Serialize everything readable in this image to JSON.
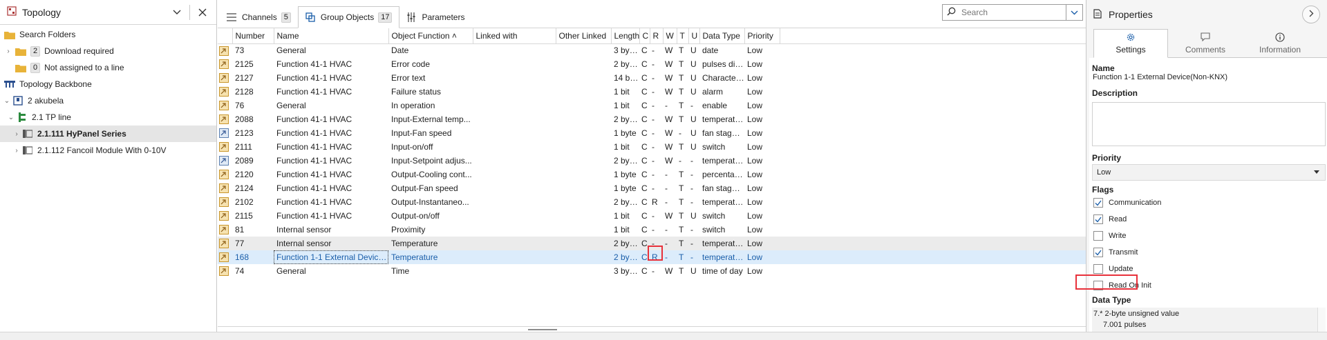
{
  "topology": {
    "title": "Topology",
    "items": [
      {
        "label": "Search Folders",
        "bold": false,
        "level": 0
      },
      {
        "label": "Download required",
        "count": "2",
        "level": 1
      },
      {
        "label": "Not assigned to a line",
        "count": "0",
        "level": 1
      },
      {
        "label": "Topology Backbone",
        "level": 0
      },
      {
        "label": "2 akubela",
        "level": 0
      },
      {
        "label": "2.1 TP line",
        "level": 1
      },
      {
        "label": "2.1.111 HyPanel Series",
        "level": 2
      },
      {
        "label": "2.1.112 Fancoil Module With 0-10V",
        "level": 2
      }
    ]
  },
  "tabs": {
    "channels": {
      "label": "Channels",
      "count": "5"
    },
    "group_objects": {
      "label": "Group Objects",
      "count": "17"
    },
    "parameters": {
      "label": "Parameters"
    }
  },
  "search": {
    "placeholder": "Search"
  },
  "grid": {
    "headers": {
      "number": "Number",
      "name": "Name",
      "object_function": "Object Function ˄",
      "linked_with": "Linked with",
      "other_linked": "Other Linked",
      "length": "Length",
      "c": "C",
      "r": "R",
      "w": "W",
      "t": "T",
      "u": "U",
      "data_type": "Data Type",
      "priority": "Priority"
    },
    "rows": [
      {
        "number": "73",
        "name": "General",
        "func": "Date",
        "length": "3 bytes",
        "c": "C",
        "r": "-",
        "w": "W",
        "t": "T",
        "u": "U",
        "dtype": "date",
        "prio": "Low"
      },
      {
        "number": "2125",
        "name": "Function 41-1 HVAC",
        "func": "Error code",
        "length": "2 bytes",
        "c": "C",
        "r": "-",
        "w": "W",
        "t": "T",
        "u": "U",
        "dtype": "pulses diff...",
        "prio": "Low"
      },
      {
        "number": "2127",
        "name": "Function 41-1 HVAC",
        "func": "Error text",
        "length": "14 bytes",
        "c": "C",
        "r": "-",
        "w": "W",
        "t": "T",
        "u": "U",
        "dtype": "Character...",
        "prio": "Low"
      },
      {
        "number": "2128",
        "name": "Function 41-1 HVAC",
        "func": "Failure status",
        "length": "1 bit",
        "c": "C",
        "r": "-",
        "w": "W",
        "t": "T",
        "u": "U",
        "dtype": "alarm",
        "prio": "Low"
      },
      {
        "number": "76",
        "name": "General",
        "func": "In operation",
        "length": "1 bit",
        "c": "C",
        "r": "-",
        "w": "-",
        "t": "T",
        "u": "-",
        "dtype": "enable",
        "prio": "Low"
      },
      {
        "number": "2088",
        "name": "Function 41-1 HVAC",
        "func": "Input-External temp...",
        "length": "2 bytes",
        "c": "C",
        "r": "-",
        "w": "W",
        "t": "T",
        "u": "U",
        "dtype": "temperatu...",
        "prio": "Low"
      },
      {
        "number": "2123",
        "name": "Function 41-1 HVAC",
        "func": "Input-Fan speed",
        "length": "1 byte",
        "c": "C",
        "r": "-",
        "w": "W",
        "t": "-",
        "u": "U",
        "dtype": "fan stage (...",
        "prio": "Low"
      },
      {
        "number": "2111",
        "name": "Function 41-1 HVAC",
        "func": "Input-on/off",
        "length": "1 bit",
        "c": "C",
        "r": "-",
        "w": "W",
        "t": "T",
        "u": "U",
        "dtype": "switch",
        "prio": "Low"
      },
      {
        "number": "2089",
        "name": "Function 41-1 HVAC",
        "func": "Input-Setpoint adjus...",
        "length": "2 bytes",
        "c": "C",
        "r": "-",
        "w": "W",
        "t": "-",
        "u": "-",
        "dtype": "temperatu...",
        "prio": "Low"
      },
      {
        "number": "2120",
        "name": "Function 41-1 HVAC",
        "func": "Output-Cooling cont...",
        "length": "1 byte",
        "c": "C",
        "r": "-",
        "w": "-",
        "t": "T",
        "u": "-",
        "dtype": "percentag...",
        "prio": "Low"
      },
      {
        "number": "2124",
        "name": "Function 41-1 HVAC",
        "func": "Output-Fan speed",
        "length": "1 byte",
        "c": "C",
        "r": "-",
        "w": "-",
        "t": "T",
        "u": "-",
        "dtype": "fan stage (...",
        "prio": "Low"
      },
      {
        "number": "2102",
        "name": "Function 41-1 HVAC",
        "func": "Output-Instantaneo...",
        "length": "2 bytes",
        "c": "C",
        "r": "R",
        "w": "-",
        "t": "T",
        "u": "-",
        "dtype": "temperatu...",
        "prio": "Low"
      },
      {
        "number": "2115",
        "name": "Function 41-1 HVAC",
        "func": "Output-on/off",
        "length": "1 bit",
        "c": "C",
        "r": "-",
        "w": "W",
        "t": "T",
        "u": "U",
        "dtype": "switch",
        "prio": "Low"
      },
      {
        "number": "81",
        "name": "Internal sensor",
        "func": "Proximity",
        "length": "1 bit",
        "c": "C",
        "r": "-",
        "w": "-",
        "t": "T",
        "u": "-",
        "dtype": "switch",
        "prio": "Low"
      },
      {
        "number": "77",
        "name": "Internal sensor",
        "func": "Temperature",
        "length": "2 bytes",
        "c": "C",
        "r": "-",
        "w": "-",
        "t": "T",
        "u": "-",
        "dtype": "temperatu...",
        "prio": "Low"
      },
      {
        "number": "168",
        "name": "Function 1-1 External Device(...",
        "func": "Temperature",
        "length": "2 bytes",
        "c": "C",
        "r": "R",
        "w": "-",
        "t": "T",
        "u": "-",
        "dtype": "temperatu...",
        "prio": "Low"
      },
      {
        "number": "74",
        "name": "General",
        "func": "Time",
        "length": "3 bytes",
        "c": "C",
        "r": "-",
        "w": "W",
        "t": "T",
        "u": "U",
        "dtype": "time of day",
        "prio": "Low"
      }
    ]
  },
  "properties": {
    "title": "Properties",
    "tabs": {
      "settings": "Settings",
      "comments": "Comments",
      "information": "Information"
    },
    "name_label": "Name",
    "name_value": "Function 1-1 External Device(Non-KNX)",
    "description_label": "Description",
    "priority_label": "Priority",
    "priority_value": "Low",
    "flags_label": "Flags",
    "flags": [
      {
        "label": "Communication",
        "checked": true
      },
      {
        "label": "Read",
        "checked": true
      },
      {
        "label": "Write",
        "checked": false
      },
      {
        "label": "Transmit",
        "checked": true
      },
      {
        "label": "Update",
        "checked": false
      },
      {
        "label": "Read On Init",
        "checked": false
      }
    ],
    "datatype_label": "Data Type",
    "datatype_line1": "7.* 2-byte unsigned value",
    "datatype_line2": "7.001 pulses"
  },
  "colors": {
    "accent": "#1a5ea9",
    "selected_row": "#dcecfb",
    "highlight_box": "#e8303a",
    "folder": "#e8b339",
    "topology_green": "#2b8a3e",
    "device_blue": "#2a4f8f"
  }
}
